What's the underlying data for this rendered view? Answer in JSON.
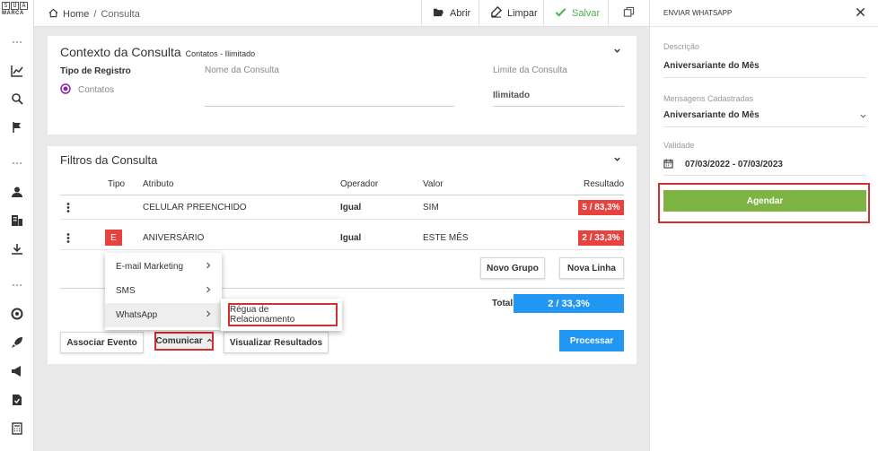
{
  "logo": {
    "letters_row1": [
      "S",
      "U",
      "A"
    ],
    "text": "MARCA"
  },
  "breadcrumb": {
    "home": "Home",
    "separator": "/",
    "current": "Consulta"
  },
  "toolbar": {
    "abrir": "Abrir",
    "limpar": "Limpar",
    "salvar": "Salvar"
  },
  "contexto": {
    "title": "Contexto da Consulta",
    "subtitle": "Contatos - Ilimitado",
    "tipo_registro_label": "Tipo de Registro",
    "tipo_registro_value": "Contatos",
    "nome_label": "Nome da Consulta",
    "nome_value": "",
    "limite_label": "Limite da Consulta",
    "limite_value": "Ilimitado"
  },
  "filtros": {
    "title": "Filtros da Consulta",
    "headers": {
      "tipo": "Tipo",
      "atributo": "Atributo",
      "operador": "Operador",
      "valor": "Valor",
      "resultado": "Resultado"
    },
    "rows": [
      {
        "tipo": "",
        "atributo": "CELULAR PREENCHIDO",
        "operador": "Igual",
        "valor": "SIM",
        "resultado": "5 / 83,3%"
      },
      {
        "tipo": "E",
        "atributo": "ANIVERSÁRIO",
        "operador": "Igual",
        "valor": "ESTE MÊS",
        "resultado": "2 / 33,3%"
      }
    ],
    "novo_grupo": "Novo Grupo",
    "nova_linha": "Nova Linha",
    "total_label": "Total",
    "total_value": "2 / 33,3%"
  },
  "actions": {
    "associar_evento": "Associar Evento",
    "comunicar": "Comunicar",
    "visualizar_resultados": "Visualizar Resultados",
    "processar": "Processar"
  },
  "comunicar_menu": {
    "items": [
      "E-mail Marketing",
      "SMS",
      "WhatsApp"
    ],
    "submenu_item": "Régua de Relacionamento"
  },
  "whatsapp_panel": {
    "title": "ENVIAR WHATSAPP",
    "descricao_label": "Descrição",
    "descricao_value": "Aniversariante do Mês",
    "mensagens_label": "Mensagens Cadastradas",
    "mensagens_value": "Aniversariante do Mês",
    "validade_label": "Validade",
    "validade_value": "07/03/2022 - 07/03/2023",
    "agendar": "Agendar"
  },
  "colors": {
    "blue": "#2196f3",
    "red": "#e8423f",
    "green": "#7cb342",
    "highlight": "#d32f2f",
    "purple": "#8e24aa"
  }
}
